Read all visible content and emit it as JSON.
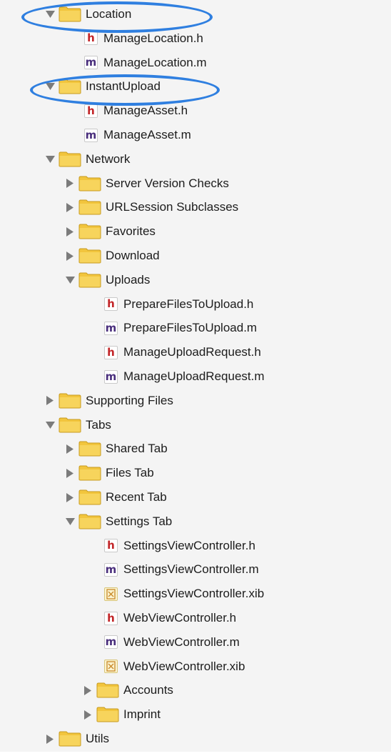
{
  "tree": [
    {
      "label": "Location",
      "kind": "folder",
      "state": "expanded",
      "depth": 0
    },
    {
      "label": "ManageLocation.h",
      "kind": "h",
      "depth": 1
    },
    {
      "label": "ManageLocation.m",
      "kind": "m",
      "depth": 1
    },
    {
      "label": "InstantUpload",
      "kind": "folder",
      "state": "expanded",
      "depth": 0
    },
    {
      "label": "ManageAsset.h",
      "kind": "h",
      "depth": 1
    },
    {
      "label": "ManageAsset.m",
      "kind": "m",
      "depth": 1
    },
    {
      "label": "Network",
      "kind": "folder",
      "state": "expanded",
      "depth": 0
    },
    {
      "label": "Server Version Checks",
      "kind": "folder",
      "state": "collapsed",
      "depth": 1
    },
    {
      "label": "URLSession Subclasses",
      "kind": "folder",
      "state": "collapsed",
      "depth": 1
    },
    {
      "label": "Favorites",
      "kind": "folder",
      "state": "collapsed",
      "depth": 1
    },
    {
      "label": "Download",
      "kind": "folder",
      "state": "collapsed",
      "depth": 1
    },
    {
      "label": "Uploads",
      "kind": "folder",
      "state": "expanded",
      "depth": 1
    },
    {
      "label": "PrepareFilesToUpload.h",
      "kind": "h",
      "depth": 2
    },
    {
      "label": "PrepareFilesToUpload.m",
      "kind": "m",
      "depth": 2
    },
    {
      "label": "ManageUploadRequest.h",
      "kind": "h",
      "depth": 2
    },
    {
      "label": "ManageUploadRequest.m",
      "kind": "m",
      "depth": 2
    },
    {
      "label": "Supporting Files",
      "kind": "folder",
      "state": "collapsed",
      "depth": 0
    },
    {
      "label": "Tabs",
      "kind": "folder",
      "state": "expanded",
      "depth": 0
    },
    {
      "label": "Shared Tab",
      "kind": "folder",
      "state": "collapsed",
      "depth": 1
    },
    {
      "label": "Files Tab",
      "kind": "folder",
      "state": "collapsed",
      "depth": 1
    },
    {
      "label": "Recent Tab",
      "kind": "folder",
      "state": "collapsed",
      "depth": 1
    },
    {
      "label": "Settings Tab",
      "kind": "folder",
      "state": "expanded",
      "depth": 1
    },
    {
      "label": "SettingsViewController.h",
      "kind": "h",
      "depth": 2
    },
    {
      "label": "SettingsViewController.m",
      "kind": "m",
      "depth": 2
    },
    {
      "label": "SettingsViewController.xib",
      "kind": "xib",
      "depth": 2
    },
    {
      "label": "WebViewController.h",
      "kind": "h",
      "depth": 2
    },
    {
      "label": "WebViewController.m",
      "kind": "m",
      "depth": 2
    },
    {
      "label": "WebViewController.xib",
      "kind": "xib",
      "depth": 2
    },
    {
      "label": "Accounts",
      "kind": "folder",
      "state": "collapsed",
      "depth": 2
    },
    {
      "label": "Imprint",
      "kind": "folder",
      "state": "collapsed",
      "depth": 2
    },
    {
      "label": "Utils",
      "kind": "folder",
      "state": "collapsed",
      "depth": 0
    }
  ],
  "icons": {
    "h": "h",
    "m": "m",
    "xib": "xib"
  },
  "colors": {
    "folder": "#f2c53d",
    "highlight_ring": "#2f7fe0",
    "h_icon": "#c22528",
    "m_icon": "#4a2f7d"
  }
}
